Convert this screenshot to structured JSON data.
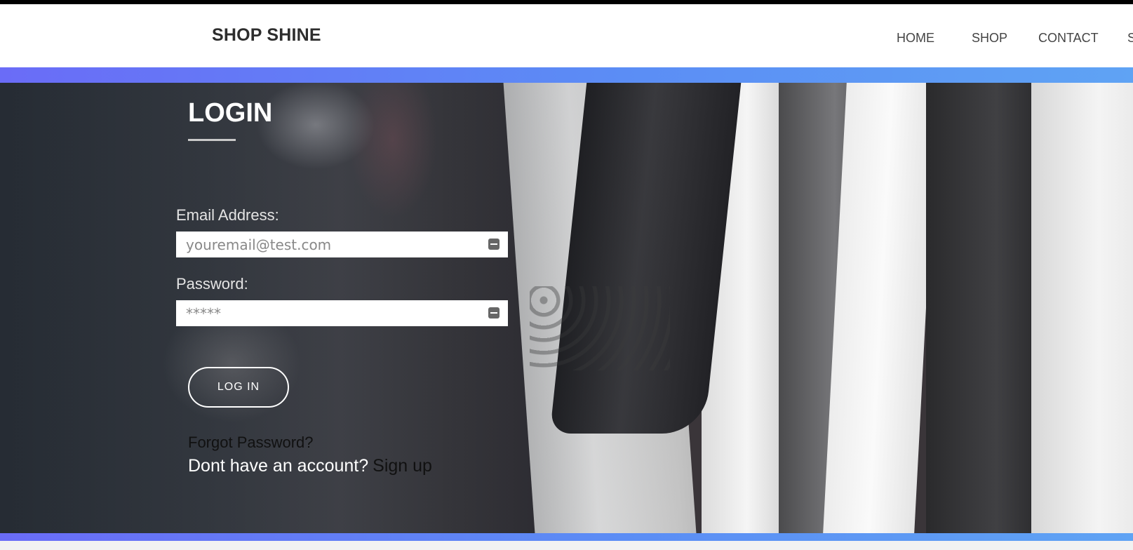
{
  "header": {
    "brand": "SHOP SHINE",
    "nav": [
      {
        "label": "HOME"
      },
      {
        "label": "SHOP"
      },
      {
        "label": "CONTACT"
      },
      {
        "label": "S"
      }
    ]
  },
  "login": {
    "title": "LOGIN",
    "email_label": "Email Address:",
    "email_placeholder": "youremail@test.com",
    "password_label": "Password:",
    "password_placeholder": "*****",
    "submit_label": "LOG IN",
    "forgot_label": "Forgot Password?",
    "account_prompt": "Dont have an account?",
    "signup_label": "Sign up"
  },
  "colors": {
    "band_start": "#6a6cf7",
    "band_end": "#5fa3f4",
    "brand_text": "#2d2d2d"
  }
}
